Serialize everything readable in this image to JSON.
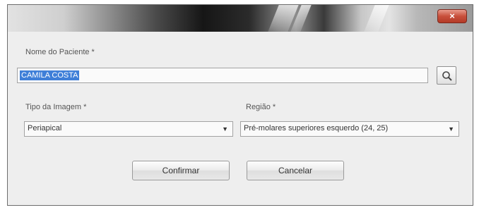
{
  "window": {
    "close_label": "×"
  },
  "patient": {
    "label": "Nome do Paciente *",
    "value": "CAMILA COSTA"
  },
  "image_type": {
    "label": "Tipo da Imagem *",
    "selected": "Periapical"
  },
  "region": {
    "label": "Região *",
    "selected": "Pré-molares superiores esquerdo (24, 25)"
  },
  "buttons": {
    "confirm": "Confirmar",
    "cancel": "Cancelar"
  },
  "icons": {
    "search": "search-icon",
    "dropdown": "chevron-down-icon",
    "close": "close-icon"
  }
}
